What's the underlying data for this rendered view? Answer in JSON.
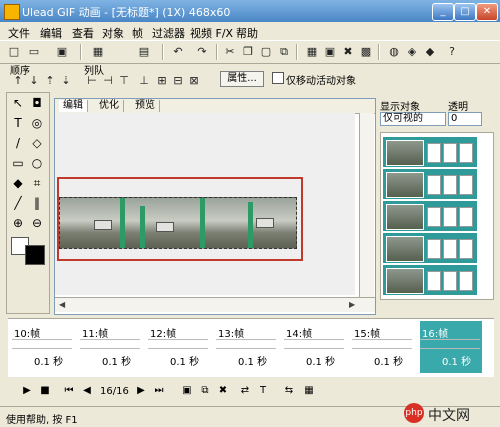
{
  "window": {
    "title": "Ulead GIF 动画 - [无标题*] (1X) 468x60",
    "min": "_",
    "max": "□",
    "close": "✕"
  },
  "menu": [
    "文件",
    "编辑",
    "查看",
    "对象",
    "帧",
    "过滤器",
    "视频 F/X",
    "帮助"
  ],
  "toolbar_icons": [
    "new-icon",
    "open-icon",
    "save-icon",
    "layout-icon",
    "undo-icon",
    "redo-icon",
    "image-icon",
    "frames-icon",
    "options-icon",
    "scissors-icon",
    "optimize-icon",
    "globe-icon",
    "help-icon"
  ],
  "sections": {
    "order": "顺序",
    "arrange": "列队"
  },
  "attr_button": "属性...",
  "move_active_only": "仅移动活动对象",
  "tabs": [
    "编辑",
    "优化",
    "预览"
  ],
  "right_panel": {
    "show_objects_label": "显示对象",
    "show_objects_value": "仅可视的",
    "opacity_label": "透明",
    "opacity_value": "0"
  },
  "frames": [
    {
      "num": "10:帧",
      "delay": "0.1 秒"
    },
    {
      "num": "11:帧",
      "delay": "0.1 秒"
    },
    {
      "num": "12:帧",
      "delay": "0.1 秒"
    },
    {
      "num": "13:帧",
      "delay": "0.1 秒"
    },
    {
      "num": "14:帧",
      "delay": "0.1 秒"
    },
    {
      "num": "15:帧",
      "delay": "0.1 秒"
    },
    {
      "num": "16:帧",
      "delay": "0.1 秒"
    }
  ],
  "playback": {
    "counter": "16/16"
  },
  "status": "使用帮助, 按 F1",
  "watermark": {
    "badge": "php",
    "text": "中文网"
  },
  "colors": {
    "accent": "#3aa9ab",
    "redbox": "#c0392b",
    "title_bar": "#4a86c6"
  }
}
